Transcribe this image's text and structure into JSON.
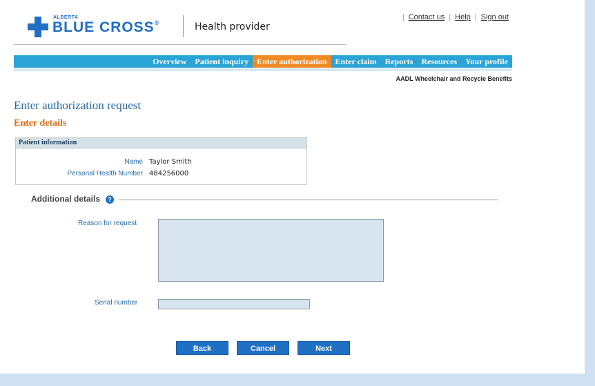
{
  "brand": {
    "small": "ALBERTA",
    "name": "BLUE CROSS",
    "reg": "®",
    "portal": "Health provider"
  },
  "toplinks": [
    "Contact us",
    "Help",
    "Sign out"
  ],
  "nav": {
    "items": [
      "Overview",
      "Patient inquiry",
      "Enter authorization",
      "Enter claim",
      "Reports",
      "Resources",
      "Your profile"
    ],
    "active_index": 2
  },
  "program": "AADL Wheelchair and Recycle Benefits",
  "page": {
    "title": "Enter authorization request",
    "subtitle": "Enter details"
  },
  "patient": {
    "header": "Patient information",
    "name_label": "Name",
    "name_value": "Taylor Smith",
    "phn_label": "Personal Health Number",
    "phn_value": "484256000"
  },
  "additional": {
    "title": "Additional details",
    "help_icon": "?",
    "reason_label": "Reason for request",
    "reason_value": "",
    "serial_label": "Serial number",
    "serial_value": ""
  },
  "buttons": {
    "back": "Back",
    "cancel": "Cancel",
    "next": "Next"
  },
  "colors": {
    "brand_blue": "#1f6fc4",
    "nav_blue": "#2aa4d6",
    "nav_active": "#f08a24",
    "subtitle_orange": "#e06a12"
  }
}
